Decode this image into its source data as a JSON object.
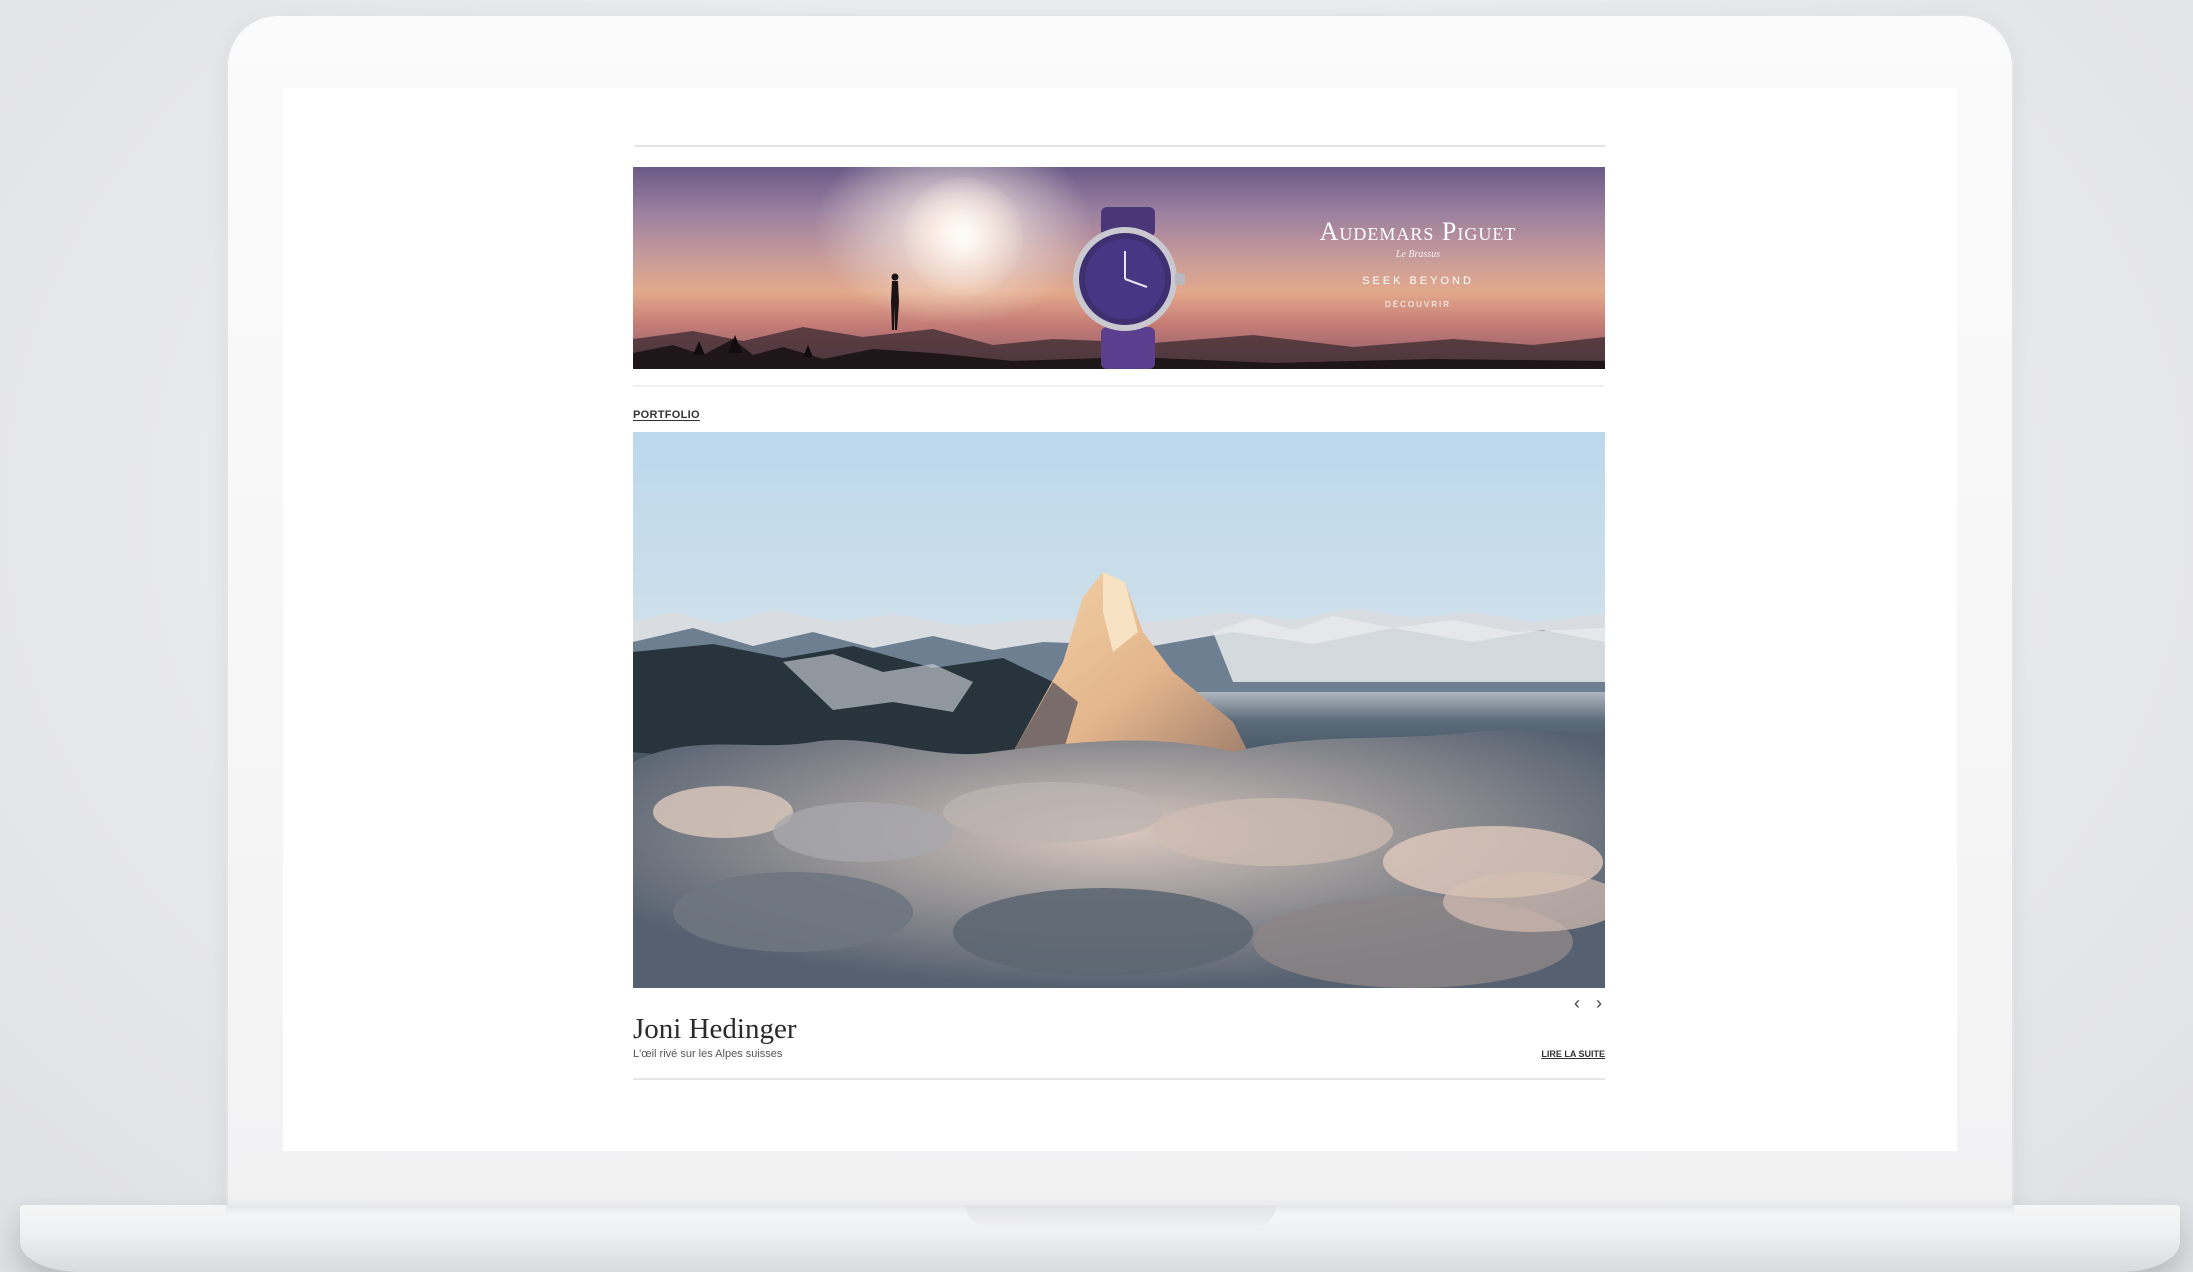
{
  "ad": {
    "brand": "Audemars Piguet",
    "tagline": "Le Brassus",
    "headline": "SEEK BEYOND",
    "cta": "DÉCOUVRIR"
  },
  "portfolio": {
    "section_label": "PORTFOLIO",
    "title": "Joni Hedinger",
    "subtitle": "L'œil rivé sur les Alpes suisses",
    "read_more": "LIRE LA SUITE",
    "prev_arrow": "‹",
    "next_arrow": "›"
  }
}
